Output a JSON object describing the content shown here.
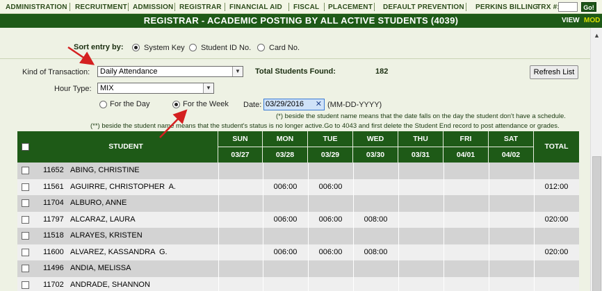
{
  "nav": {
    "items": [
      "ADMINISTRATION",
      "RECRUITMENT",
      "ADMISSION",
      "REGISTRAR",
      "FINANCIAL AID",
      "FISCAL",
      "PLACEMENT",
      "DEFAULT PREVENTION",
      "PERKINS BILLING"
    ],
    "trx_label": "TRX #:",
    "go_label": "Go!"
  },
  "titlebar": {
    "title": "REGISTRAR - ACADEMIC POSTING BY ALL ACTIVE STUDENTS (4039)",
    "view": "VIEW",
    "mode": "MOD"
  },
  "sort": {
    "label": "Sort entry by:",
    "options": [
      "System Key",
      "Student ID No.",
      "Card No."
    ],
    "selected": "System Key"
  },
  "form": {
    "transaction_label": "Kind of Transaction:",
    "transaction_value": "Daily Attendance",
    "total_label": "Total Students Found:",
    "total_value": "182",
    "hour_type_label": "Hour Type:",
    "hour_type_value": "MIX",
    "period_options": [
      "For the Day",
      "For the Week"
    ],
    "period_selected": "For the Week",
    "date_label": "Date:",
    "date_value": "03/29/2016",
    "date_format": "(MM-DD-YYYY)",
    "refresh_label": "Refresh List"
  },
  "notes": {
    "note1": "(*) beside the student name means that the date falls on the day the student don't have a schedule.",
    "note2": "(**) beside the student name means that the student's status is no longer active.Go to 4043 and first delete the Student End record to post attendance or grades."
  },
  "table": {
    "student_header": "STUDENT",
    "total_header": "TOTAL",
    "days": [
      {
        "day": "SUN",
        "date": "03/27"
      },
      {
        "day": "MON",
        "date": "03/28"
      },
      {
        "day": "TUE",
        "date": "03/29"
      },
      {
        "day": "WED",
        "date": "03/30"
      },
      {
        "day": "THU",
        "date": "03/31"
      },
      {
        "day": "FRI",
        "date": "04/01"
      },
      {
        "day": "SAT",
        "date": "04/02"
      }
    ],
    "rows": [
      {
        "id": "11652",
        "name": "ABING, CHRISTINE",
        "hours": [
          "",
          "",
          "",
          "",
          "",
          "",
          ""
        ],
        "total": ""
      },
      {
        "id": "11561",
        "name": "AGUIRRE, CHRISTOPHER  A.",
        "hours": [
          "",
          "006:00",
          "006:00",
          "",
          "",
          "",
          ""
        ],
        "total": "012:00"
      },
      {
        "id": "11704",
        "name": "ALBURO, ANNE",
        "hours": [
          "",
          "",
          "",
          "",
          "",
          "",
          ""
        ],
        "total": ""
      },
      {
        "id": "11797",
        "name": "ALCARAZ, LAURA",
        "hours": [
          "",
          "006:00",
          "006:00",
          "008:00",
          "",
          "",
          ""
        ],
        "total": "020:00"
      },
      {
        "id": "11518",
        "name": "ALRAYES, KRISTEN",
        "hours": [
          "",
          "",
          "",
          "",
          "",
          "",
          ""
        ],
        "total": ""
      },
      {
        "id": "11600",
        "name": "ALVAREZ, KASSANDRA  G.",
        "hours": [
          "",
          "006:00",
          "006:00",
          "008:00",
          "",
          "",
          ""
        ],
        "total": "020:00"
      },
      {
        "id": "11496",
        "name": "ANDIA, MELISSA",
        "hours": [
          "",
          "",
          "",
          "",
          "",
          "",
          ""
        ],
        "total": ""
      },
      {
        "id": "11702",
        "name": "ANDRADE, SHANNON",
        "hours": [
          "",
          "",
          "",
          "",
          "",
          "",
          ""
        ],
        "total": ""
      }
    ]
  },
  "colors": {
    "header_green": "#1e5a17",
    "arrow_red": "#d42020"
  }
}
